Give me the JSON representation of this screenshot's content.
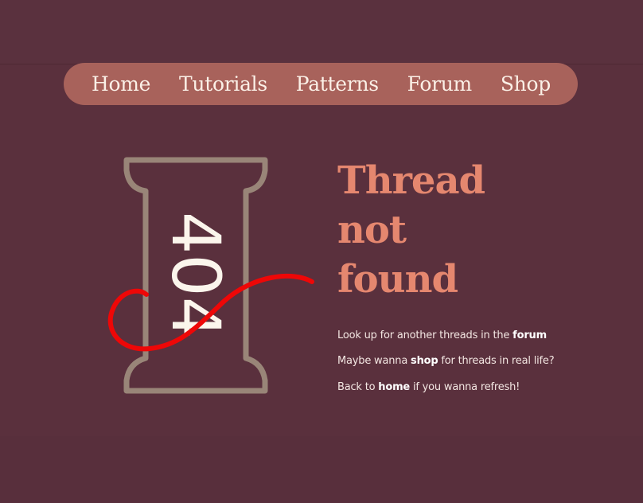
{
  "nav": {
    "items": [
      {
        "label": "Home"
      },
      {
        "label": "Tutorials"
      },
      {
        "label": "Patterns"
      },
      {
        "label": "Forum"
      },
      {
        "label": "Shop"
      }
    ]
  },
  "spool": {
    "code": "404"
  },
  "heading": {
    "lines": [
      "Thread",
      "not",
      "found"
    ]
  },
  "messages": [
    {
      "before": "Look up for another threads in the ",
      "link": "forum",
      "after": ""
    },
    {
      "before": "Maybe wanna ",
      "link": "shop",
      "after": " for threads in real life?"
    },
    {
      "before": "Back to ",
      "link": "home",
      "after": " if you wanna refresh!"
    }
  ],
  "colors": {
    "background": "#5a303d",
    "nav_bg": "#a8625b",
    "nav_text": "#fbf0e7",
    "heading": "#e5876f",
    "spool_outline": "#998578",
    "thread": "#ee0707",
    "body_text": "#f3e6e2"
  }
}
